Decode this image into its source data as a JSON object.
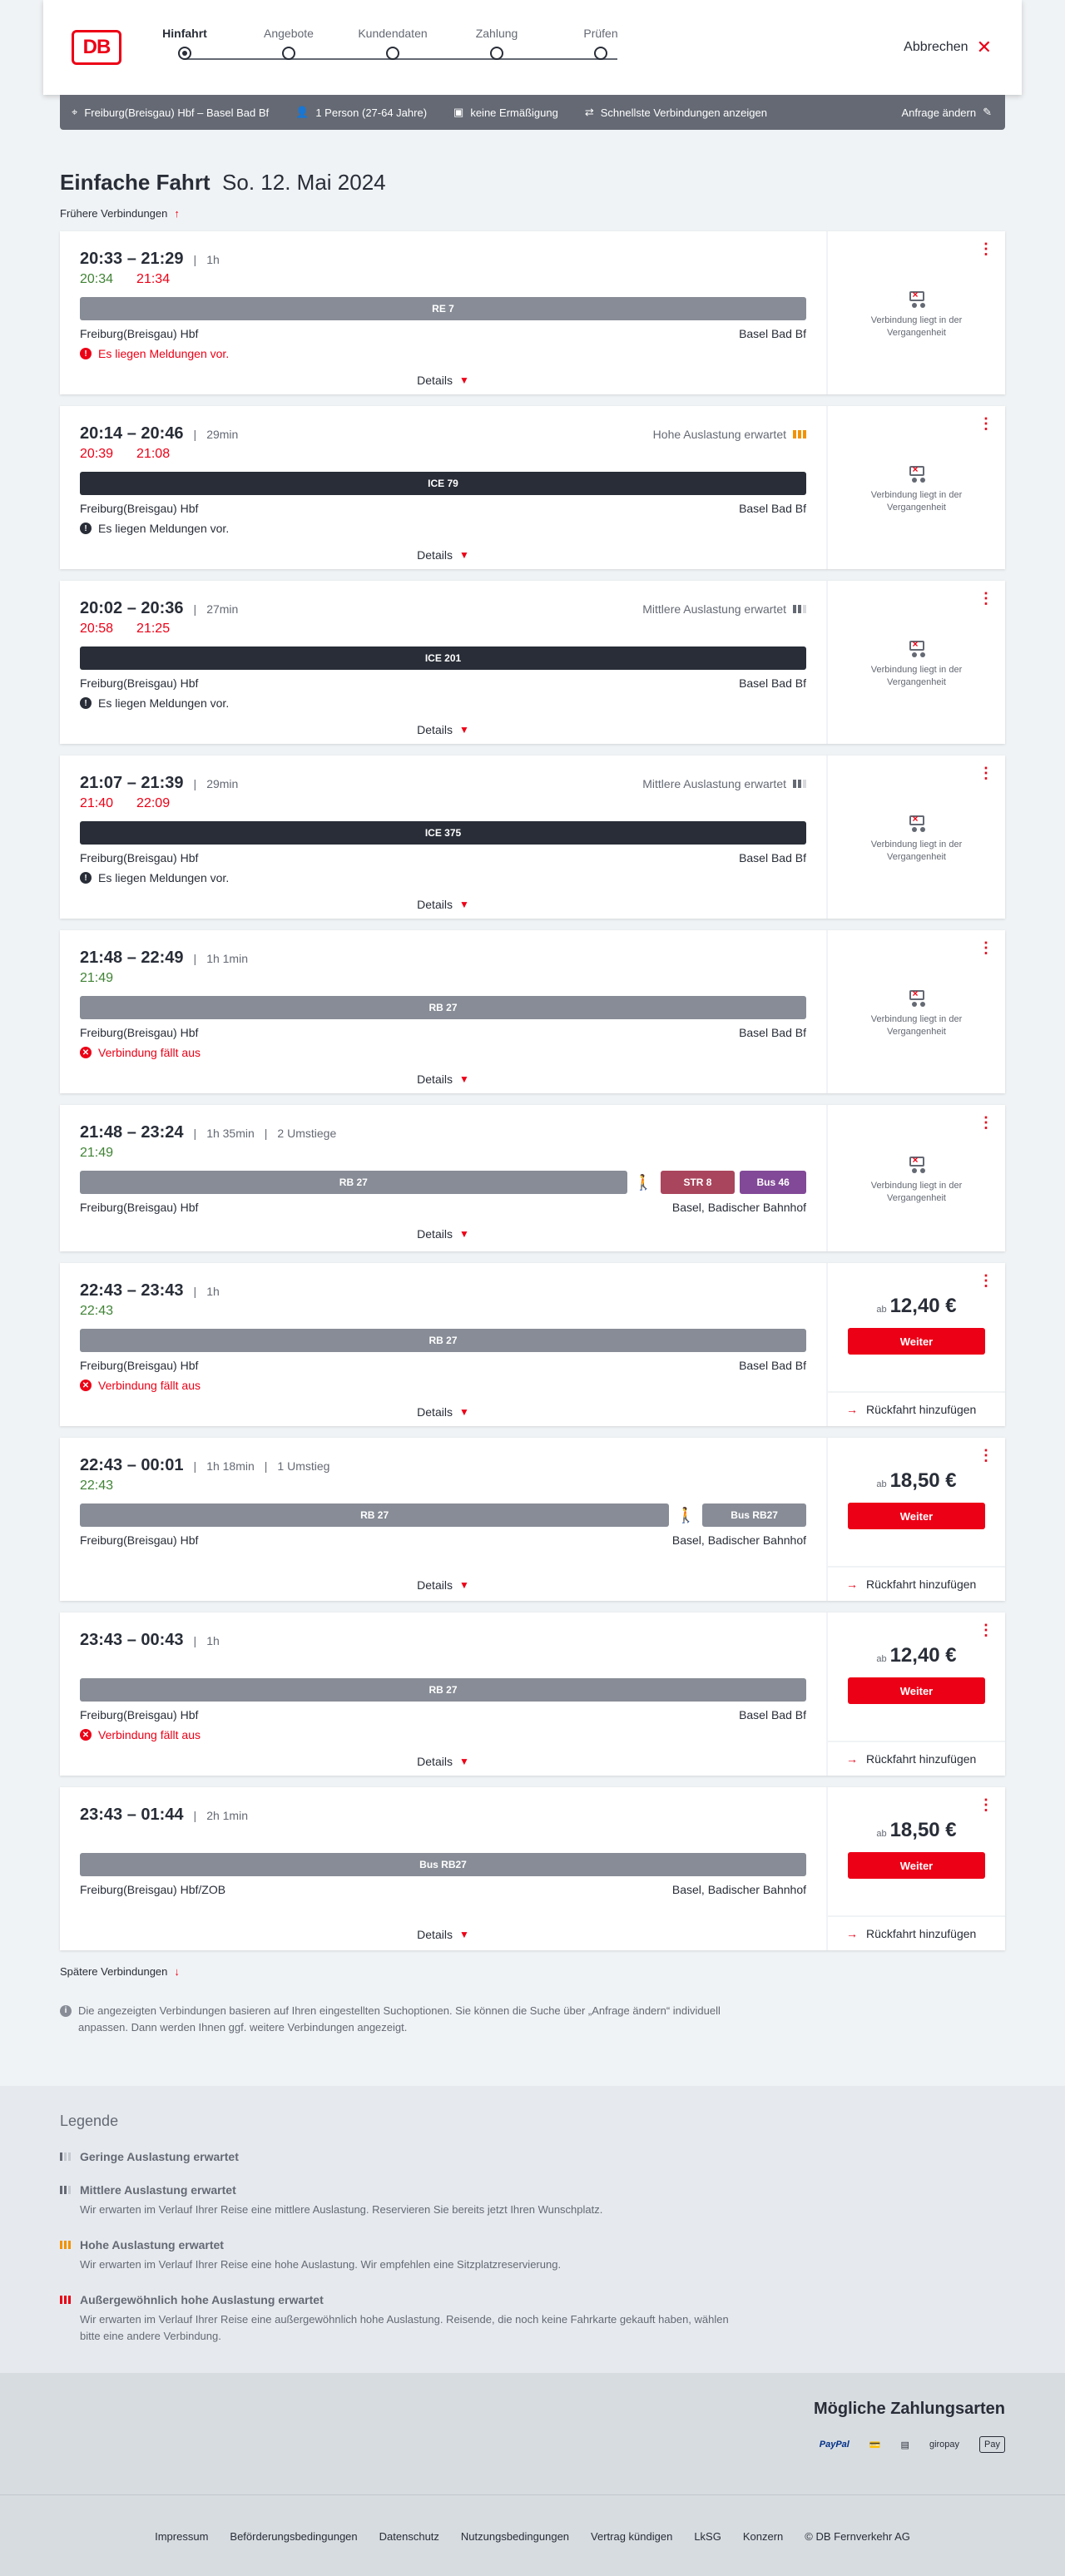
{
  "header": {
    "logo": "DB",
    "steps": [
      "Hinfahrt",
      "Angebote",
      "Kundendaten",
      "Zahlung",
      "Prüfen"
    ],
    "abort": "Abbrechen"
  },
  "summary": {
    "route": "Freiburg(Breisgau) Hbf – Basel Bad Bf",
    "persons": "1 Person (27-64 Jahre)",
    "discount": "keine Ermäßigung",
    "fastest": "Schnellste Verbindungen anzeigen",
    "change": "Anfrage ändern"
  },
  "page": {
    "title_bold": "Einfache Fahrt",
    "title_date": "So. 12. Mai 2024",
    "earlier": "Frühere Verbindungen",
    "later": "Spätere Verbindungen",
    "info": "Die angezeigten Verbindungen basieren auf Ihren eingestellten Suchoptionen. Sie können die Suche über „Anfrage ändern“ individuell anpassen. Dann werden Ihnen ggf. weitere Verbindungen angezeigt.",
    "details": "Details",
    "past": "Verbindung liegt in der Vergangenheit",
    "ab": "ab",
    "weiter": "Weiter",
    "return": "Rückfahrt hinzufügen"
  },
  "connections": [
    {
      "time": "20:33 – 21:29",
      "duration": "1h",
      "changes": "",
      "occupancy": "",
      "occ_level": 0,
      "rt_dep": "20:34",
      "rt_arr": "21:34",
      "dep_status": "ok",
      "arr_status": "late",
      "segments": [
        {
          "label": "RE 7",
          "type": "rb",
          "flex": 1
        }
      ],
      "from": "Freiburg(Breisgau) Hbf",
      "to": "Basel Bad Bf",
      "message": "Es liegen Meldungen vor.",
      "msg_type": "red",
      "price": ""
    },
    {
      "time": "20:14 – 20:46",
      "duration": "29min",
      "changes": "",
      "occupancy": "Hohe Auslastung erwartet",
      "occ_level": 3,
      "rt_dep": "20:39",
      "rt_arr": "21:08",
      "dep_status": "late",
      "arr_status": "late",
      "segments": [
        {
          "label": "ICE 79",
          "type": "ice",
          "flex": 1
        }
      ],
      "from": "Freiburg(Breisgau) Hbf",
      "to": "Basel Bad Bf",
      "message": "Es liegen Meldungen vor.",
      "msg_type": "black",
      "price": ""
    },
    {
      "time": "20:02 – 20:36",
      "duration": "27min",
      "changes": "",
      "occupancy": "Mittlere Auslastung erwartet",
      "occ_level": 2,
      "rt_dep": "20:58",
      "rt_arr": "21:25",
      "dep_status": "late",
      "arr_status": "late",
      "segments": [
        {
          "label": "ICE 201",
          "type": "ice",
          "flex": 1
        }
      ],
      "from": "Freiburg(Breisgau) Hbf",
      "to": "Basel Bad Bf",
      "message": "Es liegen Meldungen vor.",
      "msg_type": "black",
      "price": ""
    },
    {
      "time": "21:07 – 21:39",
      "duration": "29min",
      "changes": "",
      "occupancy": "Mittlere Auslastung erwartet",
      "occ_level": 2,
      "rt_dep": "21:40",
      "rt_arr": "22:09",
      "dep_status": "late",
      "arr_status": "late",
      "segments": [
        {
          "label": "ICE 375",
          "type": "ice",
          "flex": 1
        }
      ],
      "from": "Freiburg(Breisgau) Hbf",
      "to": "Basel Bad Bf",
      "message": "Es liegen Meldungen vor.",
      "msg_type": "black",
      "price": ""
    },
    {
      "time": "21:48 – 22:49",
      "duration": "1h 1min",
      "changes": "",
      "occupancy": "",
      "occ_level": 0,
      "rt_dep": "21:49",
      "rt_arr": "",
      "dep_status": "ok",
      "arr_status": "ok",
      "segments": [
        {
          "label": "RB 27",
          "type": "rb",
          "flex": 1
        }
      ],
      "from": "Freiburg(Breisgau) Hbf",
      "to": "Basel Bad Bf",
      "message": "Verbindung fällt aus",
      "msg_type": "red",
      "price": ""
    },
    {
      "time": "21:48 – 23:24",
      "duration": "1h 35min",
      "changes": "2 Umstiege",
      "occupancy": "",
      "occ_level": 0,
      "rt_dep": "21:49",
      "rt_arr": "",
      "dep_status": "ok",
      "arr_status": "ok",
      "segments": [
        {
          "label": "RB 27",
          "type": "rb",
          "flex": 660
        },
        {
          "label": "walk",
          "type": "walk",
          "flex": 0
        },
        {
          "label": "STR 8",
          "type": "str",
          "flex": 90
        },
        {
          "label": "Bus 46",
          "type": "bus",
          "flex": 80
        }
      ],
      "from": "Freiburg(Breisgau) Hbf",
      "to": "Basel, Badischer Bahnhof",
      "message": "",
      "msg_type": "",
      "price": ""
    },
    {
      "time": "22:43 – 23:43",
      "duration": "1h",
      "changes": "",
      "occupancy": "",
      "occ_level": 0,
      "rt_dep": "22:43",
      "rt_arr": "",
      "dep_status": "ok",
      "arr_status": "ok",
      "segments": [
        {
          "label": "RB 27",
          "type": "rb",
          "flex": 1
        }
      ],
      "from": "Freiburg(Breisgau) Hbf",
      "to": "Basel Bad Bf",
      "message": "Verbindung fällt aus",
      "msg_type": "red",
      "price": "12,40 €"
    },
    {
      "time": "22:43 – 00:01",
      "duration": "1h 18min",
      "changes": "1 Umstieg",
      "occupancy": "",
      "occ_level": 0,
      "rt_dep": "22:43",
      "rt_arr": "",
      "dep_status": "ok",
      "arr_status": "ok",
      "segments": [
        {
          "label": "RB 27",
          "type": "rb",
          "flex": 710
        },
        {
          "label": "walk",
          "type": "walk",
          "flex": 0
        },
        {
          "label": "Bus RB27",
          "type": "rb",
          "flex": 125
        }
      ],
      "from": "Freiburg(Breisgau) Hbf",
      "to": "Basel, Badischer Bahnhof",
      "message": "",
      "msg_type": "",
      "price": "18,50 €"
    },
    {
      "time": "23:43 – 00:43",
      "duration": "1h",
      "changes": "",
      "occupancy": "",
      "occ_level": 0,
      "rt_dep": "",
      "rt_arr": "",
      "dep_status": "ok",
      "arr_status": "ok",
      "segments": [
        {
          "label": "RB 27",
          "type": "rb",
          "flex": 1
        }
      ],
      "from": "Freiburg(Breisgau) Hbf",
      "to": "Basel Bad Bf",
      "message": "Verbindung fällt aus",
      "msg_type": "red",
      "price": "12,40 €"
    },
    {
      "time": "23:43 – 01:44",
      "duration": "2h 1min",
      "changes": "",
      "occupancy": "",
      "occ_level": 0,
      "rt_dep": "",
      "rt_arr": "",
      "dep_status": "ok",
      "arr_status": "ok",
      "segments": [
        {
          "label": "Bus RB27",
          "type": "rb",
          "flex": 1
        }
      ],
      "from": "Freiburg(Breisgau) Hbf/ZOB",
      "to": "Basel, Badischer Bahnhof",
      "message": "",
      "msg_type": "",
      "price": "18,50 €"
    }
  ],
  "legend": {
    "title": "Legende",
    "items": [
      {
        "title": "Geringe Auslastung erwartet",
        "desc": "",
        "level": 1
      },
      {
        "title": "Mittlere Auslastung erwartet",
        "desc": "Wir erwarten im Verlauf Ihrer Reise eine mittlere Auslastung. Reservieren Sie bereits jetzt Ihren Wunschplatz.",
        "level": 2
      },
      {
        "title": "Hohe Auslastung erwartet",
        "desc": "Wir erwarten im Verlauf Ihrer Reise eine hohe Auslastung. Wir empfehlen eine Sitzplatzreservierung.",
        "level": 3
      },
      {
        "title": "Außergewöhnlich hohe Auslastung erwartet",
        "desc": "Wir erwarten im Verlauf Ihrer Reise eine außergewöhnlich hohe Auslastung. Reisende, die noch keine Fahrkarte gekauft haben, wählen bitte eine andere Verbindung.",
        "level": 4
      }
    ]
  },
  "payment": {
    "title": "Mögliche Zahlungsarten",
    "methods": [
      "PayPal",
      "Kreditkarte",
      "Lastschrift",
      "giropay",
      "Pay"
    ]
  },
  "footer": {
    "links": [
      "Impressum",
      "Beförderungsbedingungen",
      "Datenschutz",
      "Nutzungsbedingungen",
      "Vertrag kündigen",
      "LkSG",
      "Konzern",
      "© DB Fernverkehr AG"
    ]
  },
  "colors": {
    "brand": "#ec0016",
    "ok": "#408335",
    "rb": "#878c96",
    "ice": "#282d37",
    "str": "#a9455d",
    "bus": "#814997",
    "occ_high": "#f39200"
  }
}
